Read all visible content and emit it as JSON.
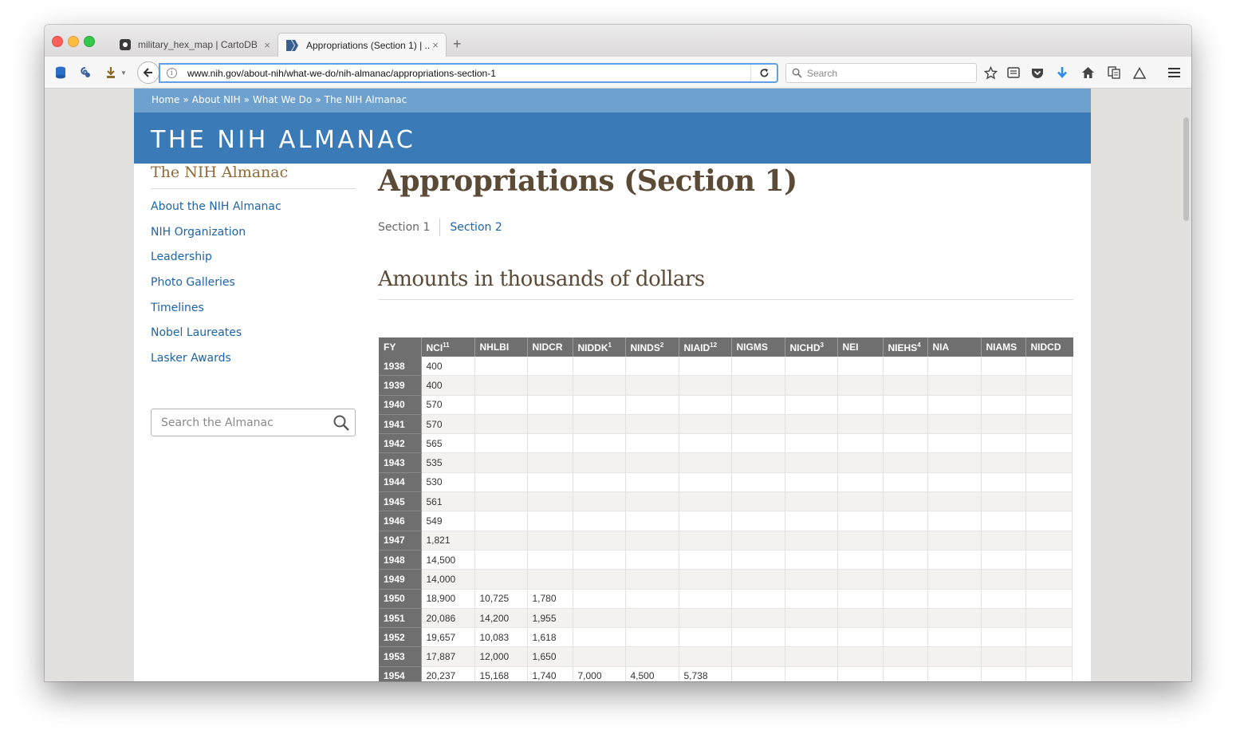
{
  "browser": {
    "tabs": [
      {
        "label": "military_hex_map | CartoDB",
        "close": "×",
        "icon": "cartodb-favicon"
      },
      {
        "label": "Appropriations (Section 1) | ...",
        "close": "×",
        "icon": "nih-favicon"
      }
    ],
    "new_tab": "+",
    "url_prefix": "www.nih.gov",
    "url_path": "/about-nih/what-we-do/nih-almanac/appropriations-section-1",
    "search_placeholder": "Search"
  },
  "site": {
    "breadcrumb": [
      "Home",
      "About NIH",
      "What We Do",
      "The NIH Almanac"
    ],
    "breadcrumb_sep": "»",
    "banner_title": "THE NIH ALMANAC"
  },
  "sidebar": {
    "title": "The NIH Almanac",
    "items": [
      {
        "label": "About the NIH Almanac"
      },
      {
        "label": "NIH Organization"
      },
      {
        "label": "Leadership"
      },
      {
        "label": "Photo Galleries"
      },
      {
        "label": "Timelines"
      },
      {
        "label": "Nobel Laureates"
      },
      {
        "label": "Lasker Awards"
      }
    ],
    "search_placeholder": "Search the Almanac"
  },
  "main": {
    "title": "Appropriations (Section 1)",
    "tabs": [
      "Section 1",
      "Section 2"
    ],
    "heading": "Amounts in thousands of dollars"
  },
  "table": {
    "columns": [
      {
        "label": "FY",
        "sup": ""
      },
      {
        "label": "NCI",
        "sup": "11"
      },
      {
        "label": "NHLBI",
        "sup": ""
      },
      {
        "label": "NIDCR",
        "sup": ""
      },
      {
        "label": "NIDDK",
        "sup": "1"
      },
      {
        "label": "NINDS",
        "sup": "2"
      },
      {
        "label": "NIAID",
        "sup": "12"
      },
      {
        "label": "NIGMS",
        "sup": ""
      },
      {
        "label": "NICHD",
        "sup": "3"
      },
      {
        "label": "NEI",
        "sup": ""
      },
      {
        "label": "NIEHS",
        "sup": "4"
      },
      {
        "label": "NIA",
        "sup": ""
      },
      {
        "label": "NIAMS",
        "sup": ""
      },
      {
        "label": "NIDCD",
        "sup": ""
      }
    ],
    "rows": [
      [
        "1938",
        "400",
        "",
        "",
        "",
        "",
        "",
        "",
        "",
        "",
        "",
        "",
        "",
        ""
      ],
      [
        "1939",
        "400",
        "",
        "",
        "",
        "",
        "",
        "",
        "",
        "",
        "",
        "",
        "",
        ""
      ],
      [
        "1940",
        "570",
        "",
        "",
        "",
        "",
        "",
        "",
        "",
        "",
        "",
        "",
        "",
        ""
      ],
      [
        "1941",
        "570",
        "",
        "",
        "",
        "",
        "",
        "",
        "",
        "",
        "",
        "",
        "",
        ""
      ],
      [
        "1942",
        "565",
        "",
        "",
        "",
        "",
        "",
        "",
        "",
        "",
        "",
        "",
        "",
        ""
      ],
      [
        "1943",
        "535",
        "",
        "",
        "",
        "",
        "",
        "",
        "",
        "",
        "",
        "",
        "",
        ""
      ],
      [
        "1944",
        "530",
        "",
        "",
        "",
        "",
        "",
        "",
        "",
        "",
        "",
        "",
        "",
        ""
      ],
      [
        "1945",
        "561",
        "",
        "",
        "",
        "",
        "",
        "",
        "",
        "",
        "",
        "",
        "",
        ""
      ],
      [
        "1946",
        "549",
        "",
        "",
        "",
        "",
        "",
        "",
        "",
        "",
        "",
        "",
        "",
        ""
      ],
      [
        "1947",
        "1,821",
        "",
        "",
        "",
        "",
        "",
        "",
        "",
        "",
        "",
        "",
        "",
        ""
      ],
      [
        "1948",
        "14,500",
        "",
        "",
        "",
        "",
        "",
        "",
        "",
        "",
        "",
        "",
        "",
        ""
      ],
      [
        "1949",
        "14,000",
        "",
        "",
        "",
        "",
        "",
        "",
        "",
        "",
        "",
        "",
        "",
        ""
      ],
      [
        "1950",
        "18,900",
        "10,725",
        "1,780",
        "",
        "",
        "",
        "",
        "",
        "",
        "",
        "",
        "",
        ""
      ],
      [
        "1951",
        "20,086",
        "14,200",
        "1,955",
        "",
        "",
        "",
        "",
        "",
        "",
        "",
        "",
        "",
        ""
      ],
      [
        "1952",
        "19,657",
        "10,083",
        "1,618",
        "",
        "",
        "",
        "",
        "",
        "",
        "",
        "",
        "",
        ""
      ],
      [
        "1953",
        "17,887",
        "12,000",
        "1,650",
        "",
        "",
        "",
        "",
        "",
        "",
        "",
        "",
        "",
        ""
      ],
      [
        "1954",
        "20,237",
        "15,168",
        "1,740",
        "7,000",
        "4,500",
        "5,738",
        "",
        "",
        "",
        "",
        "",
        "",
        ""
      ]
    ]
  },
  "colors": {
    "banner": "#3a7ab6",
    "breadcrumb_bar": "#6fa1cf",
    "link": "#1d64a8",
    "heading": "#5b4a36",
    "sidebar_title": "#8e6b3a",
    "table_header": "#6f6f6f"
  }
}
